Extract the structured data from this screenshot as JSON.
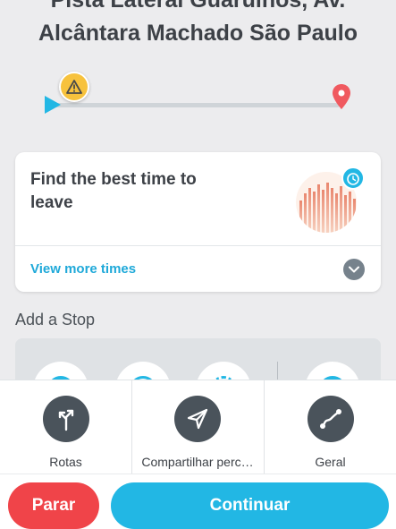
{
  "destination": {
    "line1": "Pista Lateral Guarulhos, Av.",
    "line2": "Alcântara Machado São Paulo"
  },
  "route": {
    "progress": 0.0,
    "alert_icon": "warning-icon",
    "colors": {
      "start": "#22b7e4",
      "alert": "#f7c23d",
      "destination": "#f0595f"
    }
  },
  "best_time_card": {
    "title": "Find the best time to leave",
    "link": "View more times",
    "graph_icon": "clock-icon",
    "expand_icon": "chevron-down-icon"
  },
  "add_stop": {
    "title": "Add a Stop"
  },
  "actions": [
    {
      "label": "Rotas",
      "icon": "route-split-icon"
    },
    {
      "label": "Compartilhar perc…",
      "icon": "send-icon"
    },
    {
      "label": "Geral",
      "icon": "route-overview-icon"
    }
  ],
  "buttons": {
    "stop": "Parar",
    "continue": "Continuar"
  },
  "colors": {
    "accent": "#22b7e4",
    "stop_button": "#f04449",
    "link": "#1fa9d9"
  }
}
